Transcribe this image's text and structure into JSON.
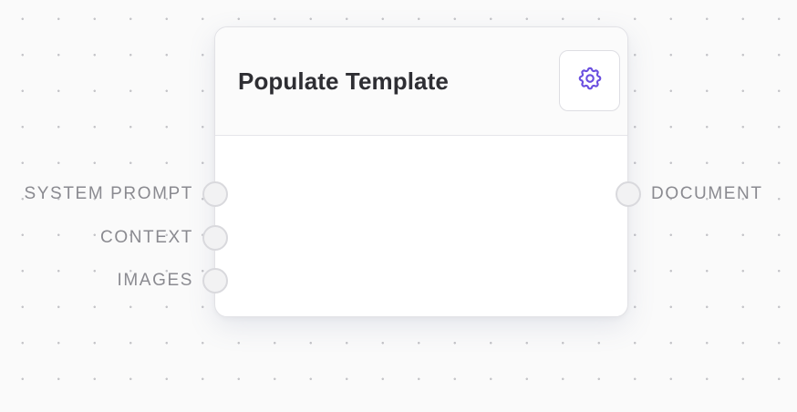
{
  "node": {
    "title": "Populate Template",
    "settings_icon": "gear-icon",
    "accent_color": "#6b4fe0"
  },
  "inputs": [
    {
      "label": "SYSTEM PROMPT"
    },
    {
      "label": "CONTEXT"
    },
    {
      "label": "IMAGES"
    }
  ],
  "outputs": [
    {
      "label": "DOCUMENT"
    }
  ]
}
